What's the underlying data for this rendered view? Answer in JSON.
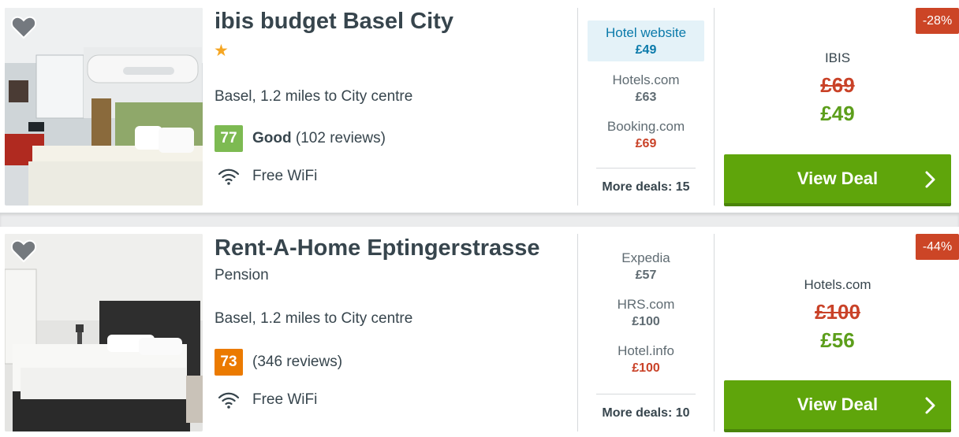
{
  "hotels": [
    {
      "name": "ibis budget Basel City",
      "stars_glyph": "★",
      "type": "",
      "location": "Basel, 1.2 miles to City centre",
      "score": "77",
      "score_word": "Good",
      "reviews": "(102 reviews)",
      "amenity": "Free WiFi",
      "alternatives": [
        {
          "provider": "Hotel website",
          "price": "£49"
        },
        {
          "provider": "Hotels.com",
          "price": "£63"
        },
        {
          "provider": "Booking.com",
          "price": "£69"
        }
      ],
      "more_deals": "More deals: 15",
      "discount": "-28%",
      "main_provider": "IBIS",
      "old_price": "£69",
      "new_price": "£49",
      "cta": "View Deal"
    },
    {
      "name": "Rent-A-Home Eptingerstrasse",
      "type": "Pension",
      "location": "Basel, 1.2 miles to City centre",
      "score": "73",
      "score_word": "",
      "reviews": "(346 reviews)",
      "amenity": "Free WiFi",
      "alternatives": [
        {
          "provider": "Expedia",
          "price": "£57"
        },
        {
          "provider": "HRS.com",
          "price": "£100"
        },
        {
          "provider": "Hotel.info",
          "price": "£100"
        }
      ],
      "more_deals": "More deals: 10",
      "discount": "-44%",
      "main_provider": "Hotels.com",
      "old_price": "£100",
      "new_price": "£56",
      "cta": "View Deal"
    }
  ],
  "icons": {
    "favorite": "heart-icon",
    "wifi": "wifi-icon",
    "cta_arrow": "chevron-right-icon",
    "star": "star-icon"
  },
  "colors": {
    "cta_green": "#5fa50b",
    "new_price_green": "#5c9e1b",
    "old_price_red": "#c94228",
    "discount_badge": "#cc4526",
    "score_good": "#7dba52",
    "score_orange": "#eb7a00",
    "highlight_blue": "#0a7aaa"
  }
}
